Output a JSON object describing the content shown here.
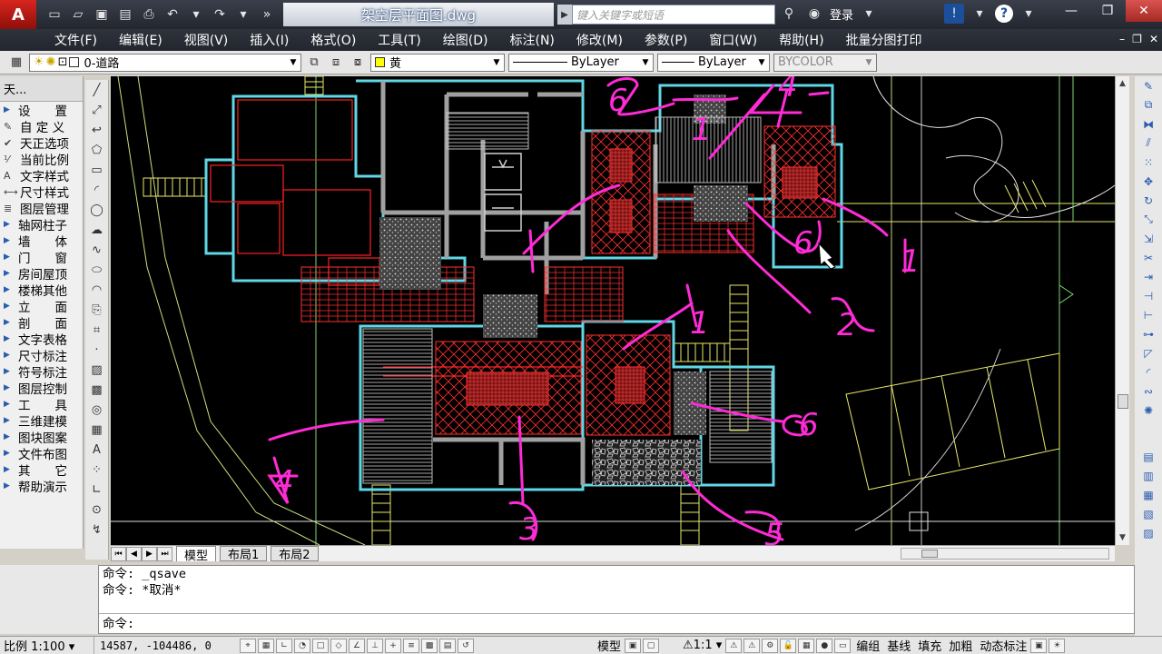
{
  "app": {
    "logo": "A",
    "doc_title": "架空层平面图.dwg",
    "search_placeholder": "键入关键字或短语",
    "login": "登录"
  },
  "menu": [
    "文件(F)",
    "编辑(E)",
    "视图(V)",
    "插入(I)",
    "格式(O)",
    "工具(T)",
    "绘图(D)",
    "标注(N)",
    "修改(M)",
    "参数(P)",
    "窗口(W)",
    "帮助(H)",
    "批量分图打印"
  ],
  "layer_toolbar": {
    "layer": "0-道路",
    "color": "黄",
    "linetype": "ByLayer",
    "lineweight": "ByLayer",
    "plotstyle": "BYCOLOR"
  },
  "left_panel": {
    "header": "天...",
    "items": [
      {
        "label": "设　　置",
        "type": "section"
      },
      {
        "label": "自 定 义",
        "type": "cmd",
        "icon": "wrench-icon"
      },
      {
        "label": "天正选项",
        "type": "cmd",
        "icon": "options-icon"
      },
      {
        "label": "当前比例",
        "type": "cmd",
        "icon": "scale-icon"
      },
      {
        "label": "文字样式",
        "type": "cmd",
        "icon": "text-style-icon"
      },
      {
        "label": "尺寸样式",
        "type": "cmd",
        "icon": "dim-style-icon"
      },
      {
        "label": "图层管理",
        "type": "cmd",
        "icon": "layers-icon"
      },
      {
        "label": "轴网柱子",
        "type": "section"
      },
      {
        "label": "墙　　体",
        "type": "section"
      },
      {
        "label": "门　　窗",
        "type": "section"
      },
      {
        "label": "房间屋顶",
        "type": "section"
      },
      {
        "label": "楼梯其他",
        "type": "section"
      },
      {
        "label": "立　　面",
        "type": "section"
      },
      {
        "label": "剖　　面",
        "type": "section"
      },
      {
        "label": "文字表格",
        "type": "section"
      },
      {
        "label": "尺寸标注",
        "type": "section"
      },
      {
        "label": "符号标注",
        "type": "section"
      },
      {
        "label": "图层控制",
        "type": "section"
      },
      {
        "label": "工　　具",
        "type": "section"
      },
      {
        "label": "三维建模",
        "type": "section"
      },
      {
        "label": "图块图案",
        "type": "section"
      },
      {
        "label": "文件布图",
        "type": "section"
      },
      {
        "label": "其　　它",
        "type": "section"
      },
      {
        "label": "帮助演示",
        "type": "section"
      }
    ]
  },
  "annotations": [
    "6",
    "4",
    "1",
    "6",
    "1",
    "2",
    "1",
    "6",
    "4",
    "3",
    "5"
  ],
  "tabs": [
    "模型",
    "布局1",
    "布局2"
  ],
  "command": {
    "history": [
      "命令: _qsave",
      "命令: *取消*"
    ],
    "prompt": "命令:"
  },
  "status": {
    "scale": "比例 1:100",
    "coords": "14587, -104486, 0",
    "model": "模型",
    "annot_scale": "1:1",
    "toggles": [
      "编组",
      "基线",
      "填充",
      "加粗",
      "动态标注"
    ]
  },
  "colors": {
    "cad_background": "#000000",
    "wall_cyan": "#5fd7e6",
    "red_lines": "#ff2020",
    "magenta_markup": "#ff2bd6",
    "yellow_lines": "#e8e86a"
  }
}
